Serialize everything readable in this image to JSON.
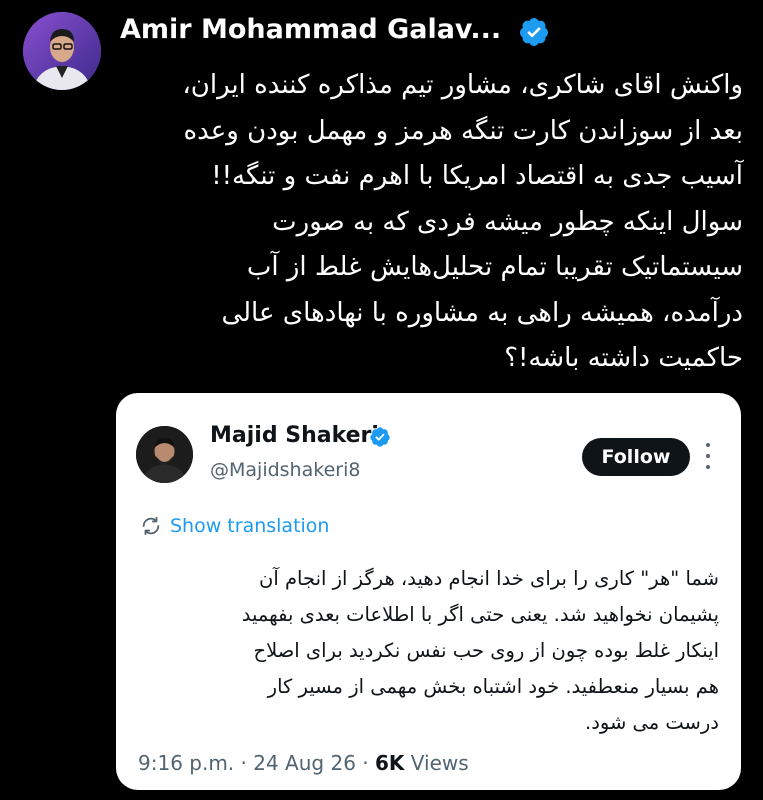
{
  "tweet": {
    "author_name": "Amir Mohammad Galav...",
    "text_lines": [
      "واکنش اقای شاکری، مشاور تیم مذاکره کننده ایران،",
      "بعد از سوزاندن کارت تنگه هرمز و مهمل بودن وعده",
      "آسیب جدی به اقتصاد امریکا با اهرم نفت و تنگه!!",
      "سوال اینکه چطور میشه فردی که به صورت",
      "سیستماتیک تقریبا تمام تحلیل‌هایش غلط از آب",
      "درآمده، همیشه راهی به مشاوره با نهادهای عالی",
      "حاکمیت داشته باشه!؟"
    ]
  },
  "quote": {
    "name": "Majid Shakeri",
    "handle": "@Majidshakeri8",
    "follow_label": "Follow",
    "translation_label": "Show translation",
    "text_lines": [
      "شما \"هر\" کاری را برای خدا انجام دهید، هرگز از انجام آن",
      "پشیمان نخواهید شد. یعنی حتی اگر با اطلاعات بعدی بفهمید",
      "اینکار غلط بوده چون از روی حب نفس نکردید برای اصلاح",
      "هم  بسیار منعطفید. خود اشتباه بخش مهمی از مسیر کار",
      "درست می شود."
    ],
    "time": "9:16 p.m.",
    "date": "24 Aug 26",
    "views_count": "6K",
    "views_label": "Views"
  },
  "colors": {
    "background": "#000000",
    "verified": "#1d9bf0",
    "link": "#1d9bf0",
    "card": "#ffffff",
    "muted": "#536471"
  },
  "icons": [
    "verified-badge-icon",
    "translate-icon",
    "more-options-icon"
  ]
}
